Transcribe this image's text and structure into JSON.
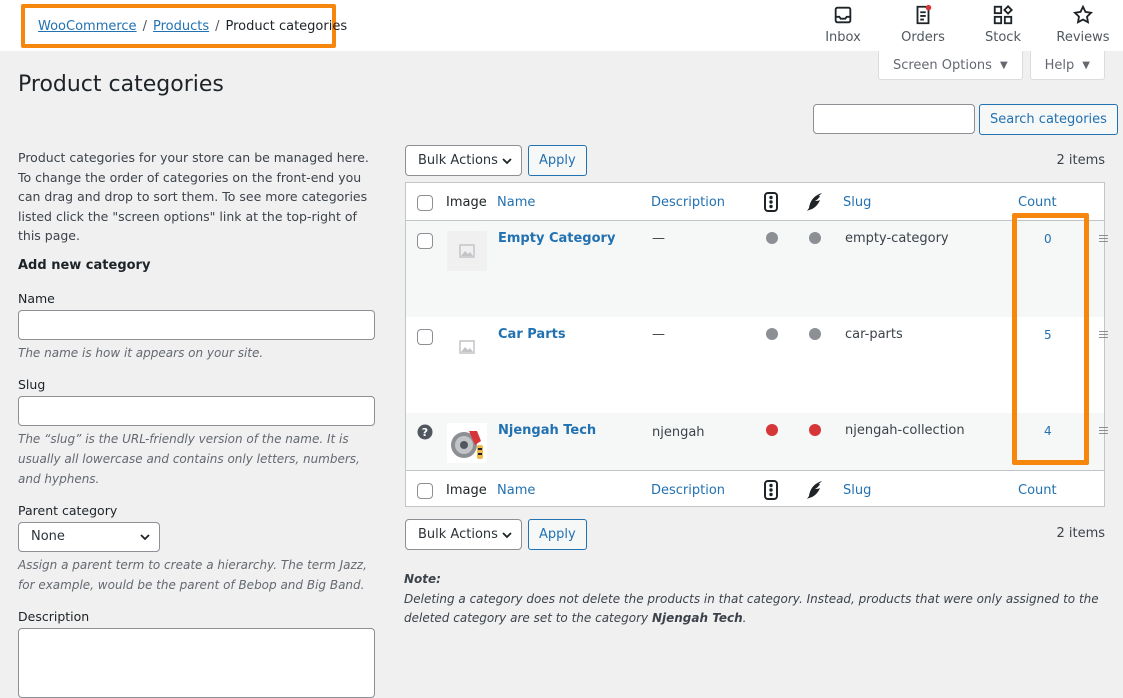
{
  "breadcrumb": {
    "woocommerce": "WooCommerce",
    "separator": "/",
    "products": "Products",
    "current": "Product categories"
  },
  "topnav": [
    {
      "label": "Inbox",
      "icon": "inbox-icon"
    },
    {
      "label": "Orders",
      "icon": "orders-icon"
    },
    {
      "label": "Stock",
      "icon": "stock-icon"
    },
    {
      "label": "Reviews",
      "icon": "star-icon"
    }
  ],
  "screen_options": "Screen Options",
  "help": "Help",
  "page_title": "Product categories",
  "search": {
    "button": "Search categories",
    "value": ""
  },
  "intro": "Product categories for your store can be managed here. To change the order of categories on the front-end you can drag and drop to sort them. To see more categories listed click the \"screen options\" link at the top-right of this page.",
  "form": {
    "heading": "Add new category",
    "name_label": "Name",
    "name_help": "The name is how it appears on your site.",
    "slug_label": "Slug",
    "slug_help": "The “slug” is the URL-friendly version of the name. It is usually all lowercase and contains only letters, numbers, and hyphens.",
    "parent_label": "Parent category",
    "parent_value": "None",
    "parent_help": "Assign a parent term to create a hierarchy. The term Jazz, for example, would be the parent of Bebop and Big Band.",
    "description_label": "Description"
  },
  "bulk": {
    "select": "Bulk Actions",
    "apply": "Apply"
  },
  "items_count": "2 items",
  "columns": {
    "image": "Image",
    "name": "Name",
    "description": "Description",
    "slug": "Slug",
    "count": "Count"
  },
  "rows": [
    {
      "name": "Empty Category",
      "description": "—",
      "slug": "empty-category",
      "count": "0",
      "status1": "#8c8f94",
      "status2": "#8c8f94"
    },
    {
      "name": "Car Parts",
      "description": "—",
      "slug": "car-parts",
      "count": "5",
      "status1": "#8c8f94",
      "status2": "#8c8f94"
    },
    {
      "name": "Njengah Tech",
      "description": "njengah",
      "slug": "njengah-collection",
      "count": "4",
      "status1": "#d63638",
      "status2": "#d63638"
    }
  ],
  "note": {
    "label": "Note:",
    "text": "Deleting a category does not delete the products in that category. Instead, products that were only assigned to the deleted category are set to the category",
    "default_category": "Njengah Tech",
    "end": "."
  },
  "colors": {
    "accent": "#2271b1",
    "highlight": "#f7870c"
  }
}
